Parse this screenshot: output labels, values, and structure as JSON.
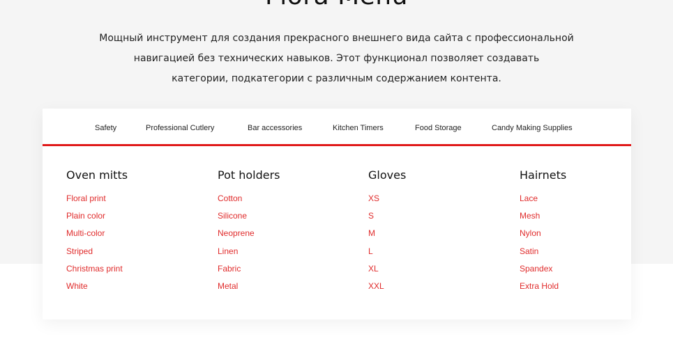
{
  "header": {
    "title": "Flora Menu",
    "intro_lines": [
      "Мощный инструмент для создания прекрасного внешнего вида сайта с профессиональной",
      "навигацией без технических навыков. Этот функционал позволяет создавать",
      "категории, подкатегории с различным содержанием контента."
    ]
  },
  "nav": {
    "items": [
      {
        "label": "Safety"
      },
      {
        "label": "Professional Cutlery"
      },
      {
        "label": "Bar accessories"
      },
      {
        "label": "Kitchen Timers"
      },
      {
        "label": "Food Storage"
      },
      {
        "label": "Candy Making Supplies"
      }
    ]
  },
  "columns": [
    {
      "title": "Oven mitts",
      "links": [
        "Floral print",
        "Plain color",
        "Multi-color",
        "Striped",
        "Christmas print",
        "White"
      ]
    },
    {
      "title": "Pot holders",
      "links": [
        "Cotton",
        "Silicone",
        "Neoprene",
        "Linen",
        "Fabric",
        "Metal"
      ]
    },
    {
      "title": "Gloves",
      "links": [
        "XS",
        "S",
        "M",
        "L",
        "XL",
        "XXL"
      ]
    },
    {
      "title": "Hairnets",
      "links": [
        "Lace",
        "Mesh",
        "Nylon",
        "Satin",
        "Spandex",
        "Extra Hold"
      ]
    }
  ],
  "colors": {
    "accent": "#e01b1b",
    "link": "#e02b2b",
    "band": "#f5f5f5",
    "text": "#222222"
  }
}
